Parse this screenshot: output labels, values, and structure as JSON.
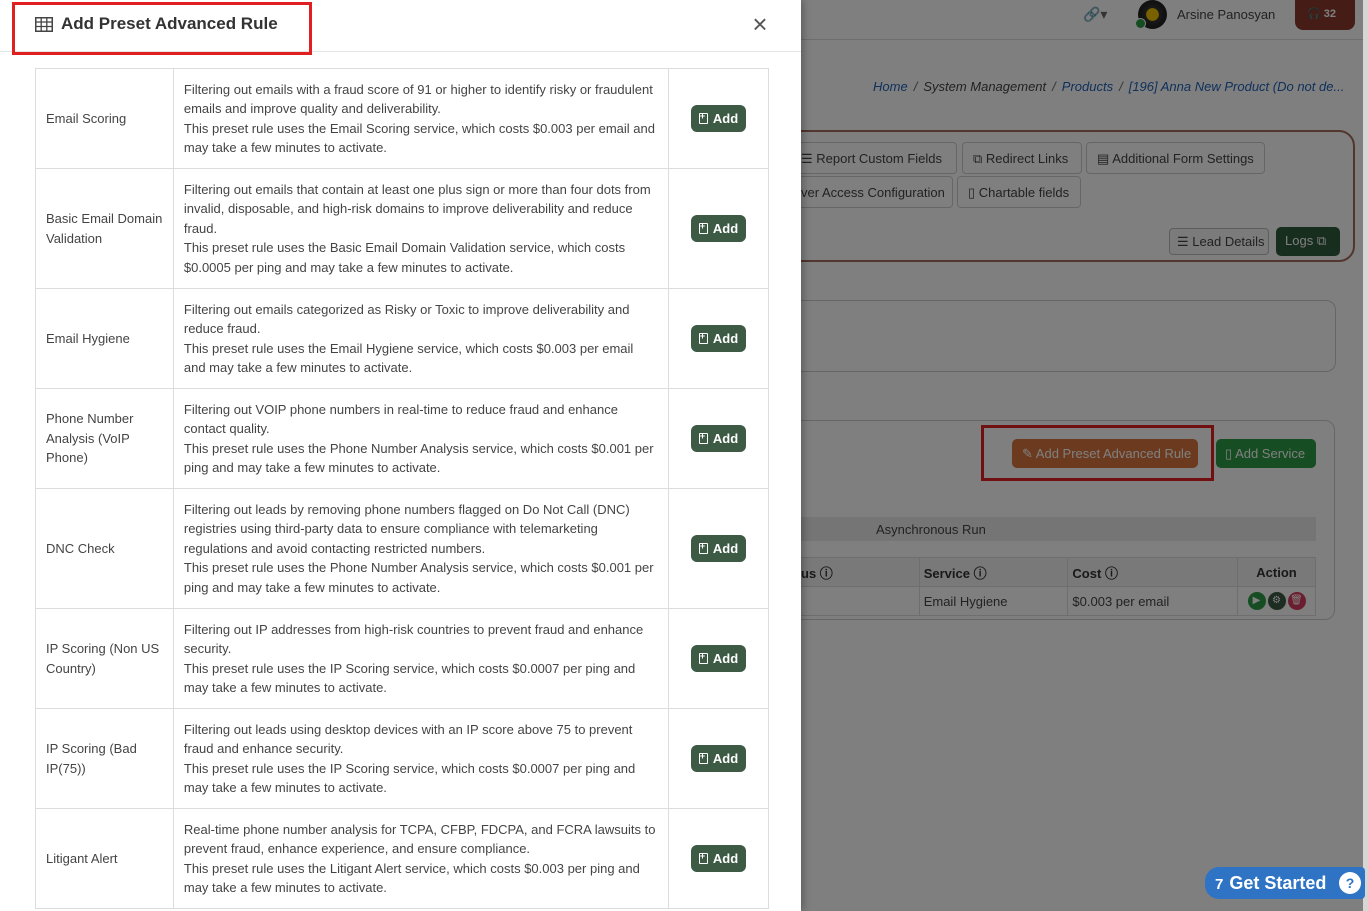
{
  "header": {
    "user_name": "Arsine Panosyan",
    "support_count": "32"
  },
  "breadcrumb": {
    "home": "Home",
    "system": "System Management",
    "products": "Products",
    "current": "[196] Anna New Product (Do not de..."
  },
  "tabs": {
    "report_custom_fields": "Report Custom Fields",
    "redirect_links": "Redirect Links",
    "additional_form_settings": "Additional Form Settings",
    "access_configuration": "ver Access Configuration",
    "chartable_fields": "Chartable fields",
    "lead_details": "Lead Details",
    "logs": "Logs"
  },
  "rules_section": {
    "add_preset_label": "Add Preset Advanced Rule",
    "add_service_label": "Add Service",
    "async_label": "Asynchronous Run",
    "columns": {
      "status": "us",
      "service": "Service",
      "cost": "Cost",
      "action": "Action"
    },
    "row": {
      "service": "Email Hygiene",
      "cost": "$0.003 per email"
    }
  },
  "get_started": {
    "count": "7",
    "label": "Get Started",
    "help": "?"
  },
  "modal": {
    "title": "Add Preset Advanced Rule",
    "close": "×",
    "add_label": "Add",
    "rules": [
      {
        "name": "Email Scoring",
        "desc1": "Filtering out emails with a fraud score of 91 or higher to identify risky or fraudulent emails and improve quality and deliverability.",
        "desc2": "This preset rule uses the Email Scoring service, which costs $0.003 per email and may take a few minutes to activate."
      },
      {
        "name": "Basic Email Domain Validation",
        "desc1": "Filtering out emails that contain at least one plus sign or more than four dots from invalid, disposable, and high-risk domains to improve deliverability and reduce fraud.",
        "desc2": "This preset rule uses the Basic Email Domain Validation service, which costs $0.0005 per ping and may take a few minutes to activate."
      },
      {
        "name": "Email Hygiene",
        "desc1": "Filtering out emails categorized as Risky or Toxic to improve deliverability and reduce fraud.",
        "desc2": "This preset rule uses the Email Hygiene service, which costs $0.003 per email and may take a few minutes to activate."
      },
      {
        "name": "Phone Number Analysis (VoIP Phone)",
        "desc1": "Filtering out VOIP phone numbers in real-time to reduce fraud and enhance contact quality.",
        "desc2": "This preset rule uses the Phone Number Analysis service, which costs $0.001 per ping and may take a few minutes to activate."
      },
      {
        "name": "DNC Check",
        "desc1": "Filtering out leads by removing phone numbers flagged on Do Not Call (DNC) registries using third-party data to ensure compliance with telemarketing regulations and avoid contacting restricted numbers.",
        "desc2": "This preset rule uses the Phone Number Analysis service, which costs $0.001 per ping and may take a few minutes to activate."
      },
      {
        "name": "IP Scoring (Non US Country)",
        "desc1": "Filtering out IP addresses from high-risk countries to prevent fraud and enhance security.",
        "desc2": "This preset rule uses the IP Scoring service, which costs $0.0007 per ping and may take a few minutes to activate."
      },
      {
        "name": "IP Scoring (Bad IP(75))",
        "desc1": "Filtering out leads using desktop devices with an IP score above 75 to prevent fraud and enhance security.",
        "desc2": "This preset rule uses the IP Scoring service, which costs $0.0007 per ping and may take a few minutes to activate."
      },
      {
        "name": "Litigant Alert",
        "desc1": "Real-time phone number analysis for TCPA, CFBP, FDCPA, and FCRA lawsuits to prevent fraud, enhance experience, and ensure compliance.",
        "desc2": "This preset rule uses the Litigant Alert service, which costs $0.003 per ping and may take a few minutes to activate."
      }
    ]
  }
}
